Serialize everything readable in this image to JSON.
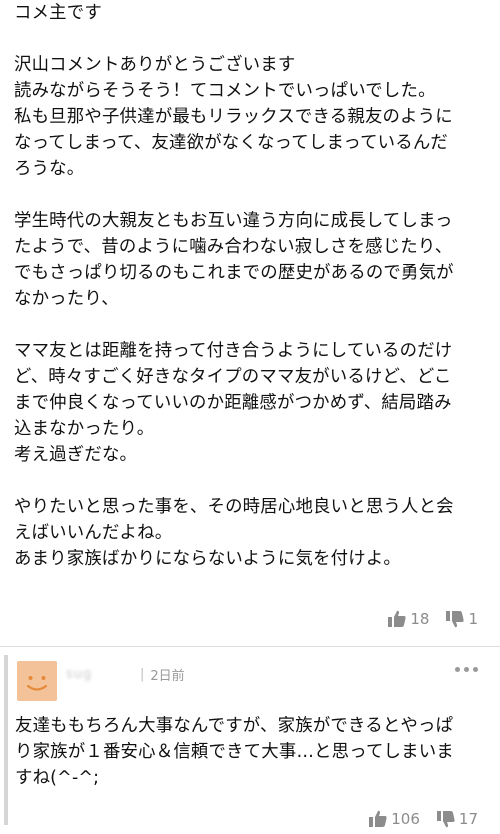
{
  "comment": {
    "lines": [
      "コメ主です",
      "",
      "沢山コメントありがとうございます",
      "読みながらそうそう！てコメントでいっぱいでした。",
      "私も旦那や子供達が最もリラックスできる親友のように",
      "なってしまって、友達欲がなくなってしまっているんだ",
      "ろうな。",
      "",
      "学生時代の大親友ともお互い違う方向に成長してしまっ",
      "たようで、昔のように噛み合わない寂しさを感じたり、",
      "でもさっぱり切るのもこれまでの歴史があるので勇気が",
      "なかったり、",
      "",
      "ママ友とは距離を持って付き合うようにしているのだけ",
      "ど、時々すごく好きなタイプのママ友がいるけど、どこ",
      "まで仲良くなっていいのか距離感がつかめず、結局踏み",
      "込まなかったり。",
      "考え過ぎだな。",
      "",
      "やりたいと思った事を、その時居心地良いと思う人と会",
      "えばいいんだよね。",
      "あまり家族ばかりにならないように気を付けよ。"
    ],
    "likes": "18",
    "dislikes": "1"
  },
  "reply": {
    "user": "sug",
    "separator": "|",
    "time": "2日前",
    "lines": [
      "友達ももちろん大事なんですが、家族ができるとやっぱ",
      "り家族が１番安心＆信頼できて大事…と思ってしまいま",
      "すね(^-^;"
    ],
    "likes": "106",
    "dislikes": "17"
  },
  "icons": {
    "like": "thumbs-up-icon",
    "dislike": "thumbs-down-icon",
    "more": "more-dots-icon",
    "avatar": "smiley-avatar"
  },
  "colors": {
    "avatar_bg": "#f4c298",
    "meta_text": "#9a9a9a"
  }
}
